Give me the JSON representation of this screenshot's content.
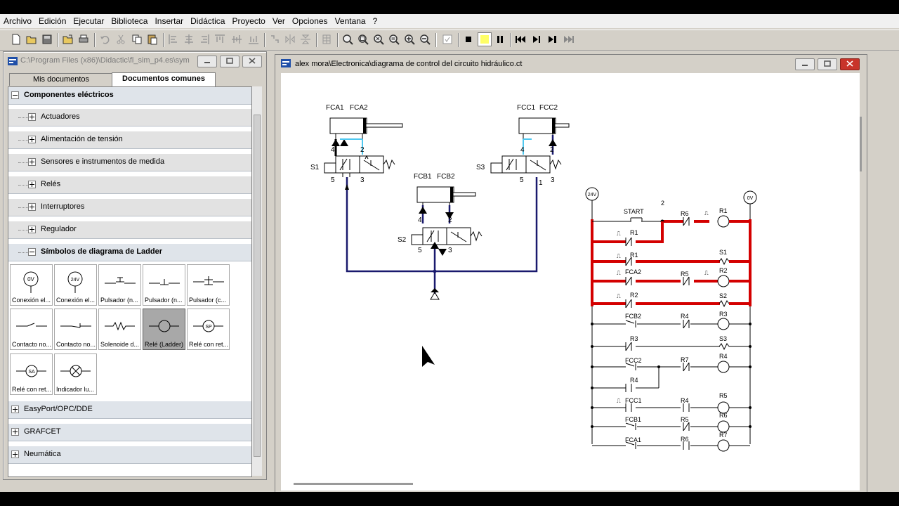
{
  "menu": [
    "Archivo",
    "Edición",
    "Ejecutar",
    "Biblioteca",
    "Insertar",
    "Didáctica",
    "Proyecto",
    "Ver",
    "Opciones",
    "Ventana",
    "?"
  ],
  "left_window": {
    "title": "C:\\Program Files (x86)\\Didactic\\fl_sim_p4.es\\sym",
    "tabs": [
      "Mis documentos",
      "Documentos comunes"
    ],
    "categories": {
      "componentes": "Componentes eléctricos",
      "actuadores": "Actuadores",
      "alimentacion": "Alimentación de tensión",
      "sensores": "Sensores e instrumentos de medida",
      "reles": "Relés",
      "interruptores": "Interruptores",
      "regulador": "Regulador",
      "ladder": "Símbolos de diagrama de Ladder",
      "easyport": "EasyPort/OPC/DDE",
      "grafcet": "GRAFCET",
      "neumatica": "Neumática"
    },
    "tiles": [
      "Conexión el...",
      "Conexión el...",
      "Pulsador (n...",
      "Pulsador (n...",
      "Pulsador (c...",
      "Contacto no...",
      "Contacto no...",
      "Solenoide d...",
      "Relé (Ladder)",
      "Relé con ret...",
      "Relé con ret...",
      "Indicador lu..."
    ],
    "tile_glyphs": [
      "0V",
      "24V",
      "",
      "",
      "",
      "",
      "",
      "",
      "",
      "SP",
      "SA",
      ""
    ]
  },
  "right_window": {
    "title": "alex mora\\Electronica\\diagrama de control del circuito hidráulico.ct"
  },
  "circuit": {
    "cyl1": [
      "FCA1",
      "FCA2"
    ],
    "cyl2": [
      "FCB1",
      "FCB2"
    ],
    "cyl3": [
      "FCC1",
      "FCC2"
    ],
    "valves": [
      "S1",
      "S2",
      "S3"
    ],
    "ports": [
      "4",
      "2",
      "5",
      "3",
      "1"
    ],
    "ladder": {
      "supply": "24V",
      "ground": "0V",
      "node": "2",
      "rows": [
        {
          "a": "START",
          "b": "R6",
          "out": "R1"
        },
        {
          "a": "R1"
        },
        {
          "a": "R1",
          "out": "S1"
        },
        {
          "a": "FCA2",
          "b": "R5",
          "out": "R2"
        },
        {
          "a": "R2",
          "out": "S2"
        },
        {
          "a": "FCB2",
          "b": "R4",
          "out": "R3"
        },
        {
          "a": "R3",
          "out": "S3"
        },
        {
          "a": "FCC2",
          "b": "R7",
          "out": "R4"
        },
        {
          "a": "R4"
        },
        {
          "a": "FCC1",
          "b": "R4",
          "out": "R5"
        },
        {
          "a": "FCB1",
          "b": "R5",
          "out": "R6"
        },
        {
          "a": "FCA1",
          "b": "R6",
          "out": "R7"
        }
      ]
    }
  },
  "colors": {
    "active": "#d40000",
    "line": "#1a1a6e",
    "accent": "#1e78d2",
    "highlight": "#ffff66"
  }
}
